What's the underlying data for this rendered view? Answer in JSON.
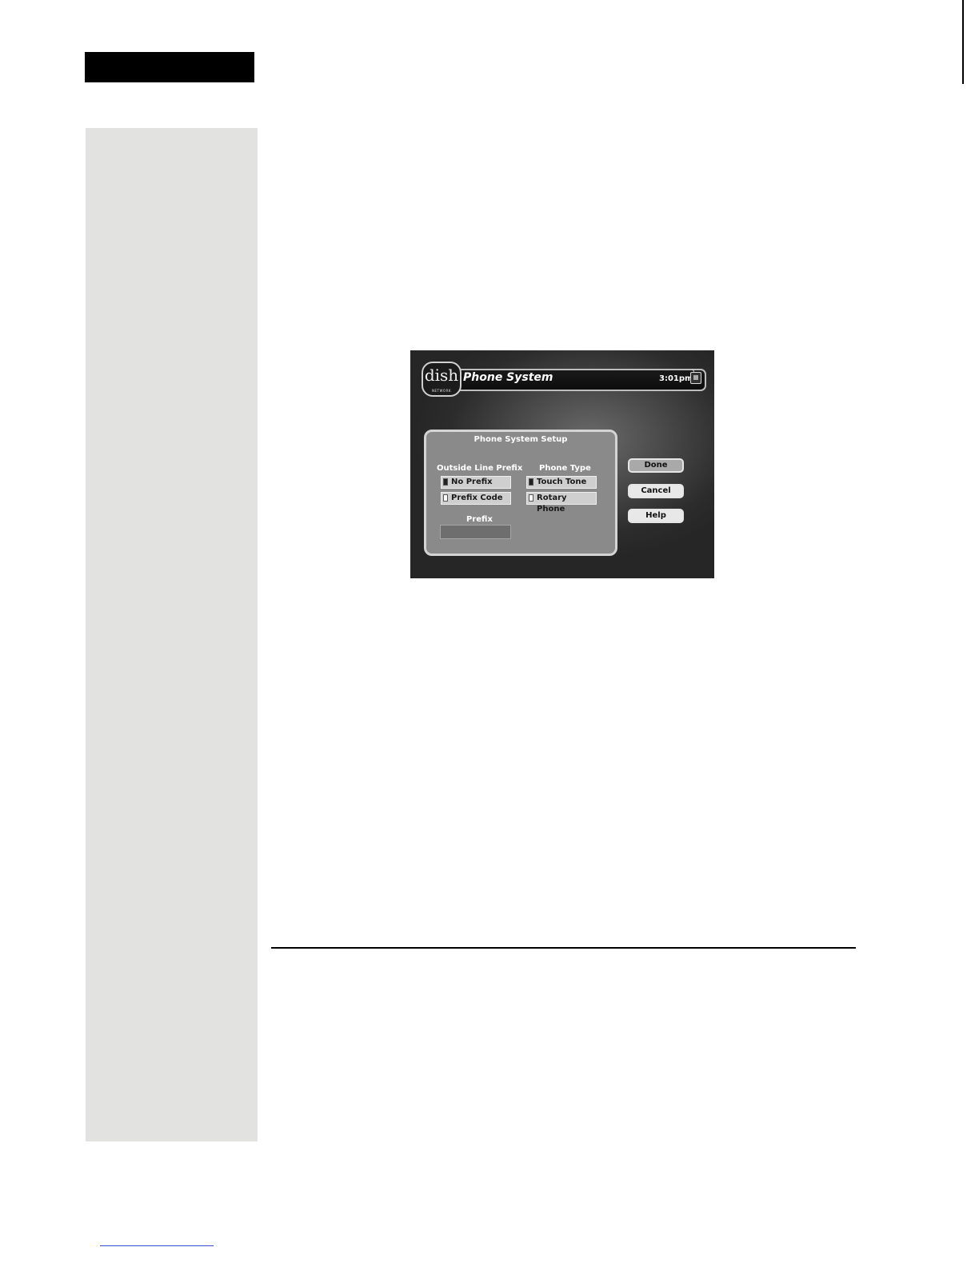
{
  "screen": {
    "logo": {
      "main": "dish",
      "sub": "NETWORK"
    },
    "title": "Phone System",
    "clock": "3:01pm",
    "panel": {
      "title": "Phone System Setup",
      "outside_line_prefix": {
        "header": "Outside Line Prefix",
        "options": [
          {
            "label": "No Prefix",
            "selected": true
          },
          {
            "label": "Prefix Code",
            "selected": false
          }
        ]
      },
      "phone_type": {
        "header": "Phone Type",
        "options": [
          {
            "label": "Touch Tone",
            "selected": true
          },
          {
            "label": "Rotary Phone",
            "selected": false
          }
        ]
      },
      "prefix": {
        "label": "Prefix",
        "value": ""
      }
    },
    "buttons": {
      "done": "Done",
      "cancel": "Cancel",
      "help": "Help"
    }
  }
}
